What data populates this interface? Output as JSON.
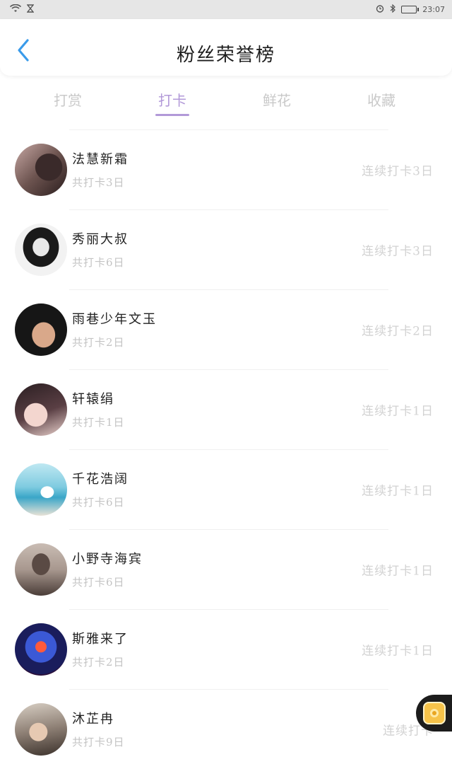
{
  "status_bar": {
    "time": "23:07",
    "icons": [
      "wifi-icon",
      "hourglass-icon",
      "alarm-icon",
      "bluetooth-icon",
      "battery-icon"
    ]
  },
  "header": {
    "title": "粉丝荣誉榜",
    "back_icon": "chevron-left-icon",
    "accent_color": "#3a9bea"
  },
  "tabs": [
    {
      "label": "打赏",
      "active": false
    },
    {
      "label": "打卡",
      "active": true
    },
    {
      "label": "鲜花",
      "active": false
    },
    {
      "label": "收藏",
      "active": false
    }
  ],
  "tab_active_color": "#b299d8",
  "fans": [
    {
      "name": "法慧新霜",
      "total": "共打卡3日",
      "streak": "连续打卡3日"
    },
    {
      "name": "秀丽大叔",
      "total": "共打卡6日",
      "streak": "连续打卡3日"
    },
    {
      "name": "雨巷少年文玉",
      "total": "共打卡2日",
      "streak": "连续打卡2日"
    },
    {
      "name": "轩辕绢",
      "total": "共打卡1日",
      "streak": "连续打卡1日"
    },
    {
      "name": "千花浩阔",
      "total": "共打卡6日",
      "streak": "连续打卡1日"
    },
    {
      "name": "小野寺海宾",
      "total": "共打卡6日",
      "streak": "连续打卡1日"
    },
    {
      "name": "斯雅来了",
      "total": "共打卡2日",
      "streak": "连续打卡1日"
    },
    {
      "name": "沐芷冉",
      "total": "共打卡9日",
      "streak": "连续打卡"
    }
  ],
  "floating_button_icon": "chat-icon"
}
